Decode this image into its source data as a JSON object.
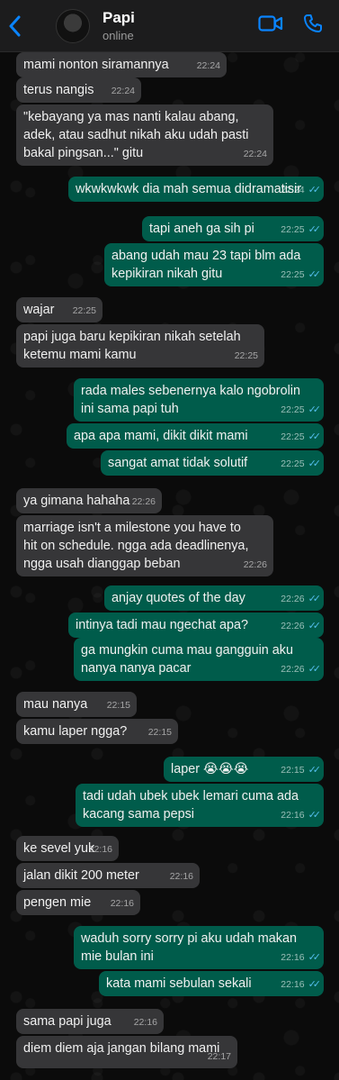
{
  "header": {
    "name": "Papi",
    "status": "online"
  },
  "colors": {
    "incoming": "#363638",
    "outgoing": "#005c4b",
    "accent": "#0a84ff",
    "read_ticks": "#53bdeb"
  },
  "icons": {
    "back": "chevron-left-icon",
    "video": "video-call-icon",
    "phone": "phone-call-icon",
    "read": "double-check-icon"
  },
  "messages": [
    {
      "dir": "in",
      "text": "mami nonton siramannya",
      "time": "22:24"
    },
    {
      "dir": "in",
      "text": "terus nangis",
      "time": "22:24"
    },
    {
      "dir": "in",
      "text": "\"kebayang ya mas nanti kalau abang,\nadek, atau sadhut nikah aku udah pasti\nbakal pingsan...\" gitu",
      "time": "22:24"
    },
    {
      "dir": "out",
      "text": "wkwkwkwk dia mah semua didramatisir",
      "time": "22:24"
    },
    {
      "dir": "out",
      "text": "tapi aneh ga sih pi",
      "time": "22:25"
    },
    {
      "dir": "out",
      "text": "abang udah mau 23 tapi blm ada\nkepikiran nikah gitu",
      "time": "22:25"
    },
    {
      "dir": "in",
      "text": "wajar",
      "time": "22:25"
    },
    {
      "dir": "in",
      "text": "papi juga baru kepikiran nikah setelah\nketemu mami kamu",
      "time": "22:25"
    },
    {
      "dir": "out",
      "text": "rada males sebenernya kalo ngobrolin\nini sama papi tuh",
      "time": "22:25"
    },
    {
      "dir": "out",
      "text": "apa apa mami, dikit dikit mami",
      "time": "22:25"
    },
    {
      "dir": "out",
      "text": "sangat amat tidak solutif",
      "time": "22:25"
    },
    {
      "dir": "in",
      "text": "ya gimana hahaha",
      "time": "22:26"
    },
    {
      "dir": "in",
      "text": "marriage isn't a milestone you have to\nhit on schedule. ngga ada deadlinenya,\nngga usah dianggap beban",
      "time": "22:26"
    },
    {
      "dir": "out",
      "text": "anjay quotes of the day",
      "time": "22:26"
    },
    {
      "dir": "out",
      "text": "intinya tadi mau ngechat apa?",
      "time": "22:26"
    },
    {
      "dir": "out",
      "text": "ga mungkin cuma mau gangguin aku\nnanya nanya pacar",
      "time": "22:26"
    },
    {
      "dir": "in",
      "text": "mau nanya",
      "time": "22:15"
    },
    {
      "dir": "in",
      "text": "kamu laper ngga?",
      "time": "22:15"
    },
    {
      "dir": "out",
      "text": "laper 😭😭😭",
      "time": "22:15"
    },
    {
      "dir": "out",
      "text": "tadi udah ubek ubek lemari cuma ada\nkacang sama pepsi",
      "time": "22:16"
    },
    {
      "dir": "in",
      "text": "ke sevel yuk",
      "time": "22:16"
    },
    {
      "dir": "in",
      "text": "jalan dikit 200 meter",
      "time": "22:16"
    },
    {
      "dir": "in",
      "text": "pengen mie",
      "time": "22:16"
    },
    {
      "dir": "out",
      "text": "waduh sorry sorry pi aku udah makan\nmie bulan ini",
      "time": "22:16"
    },
    {
      "dir": "out",
      "text": "kata mami sebulan sekali",
      "time": "22:16"
    },
    {
      "dir": "in",
      "text": "sama papi juga",
      "time": "22:16"
    },
    {
      "dir": "in",
      "text": "diem diem aja jangan bilang mami",
      "time": "22:17"
    }
  ]
}
